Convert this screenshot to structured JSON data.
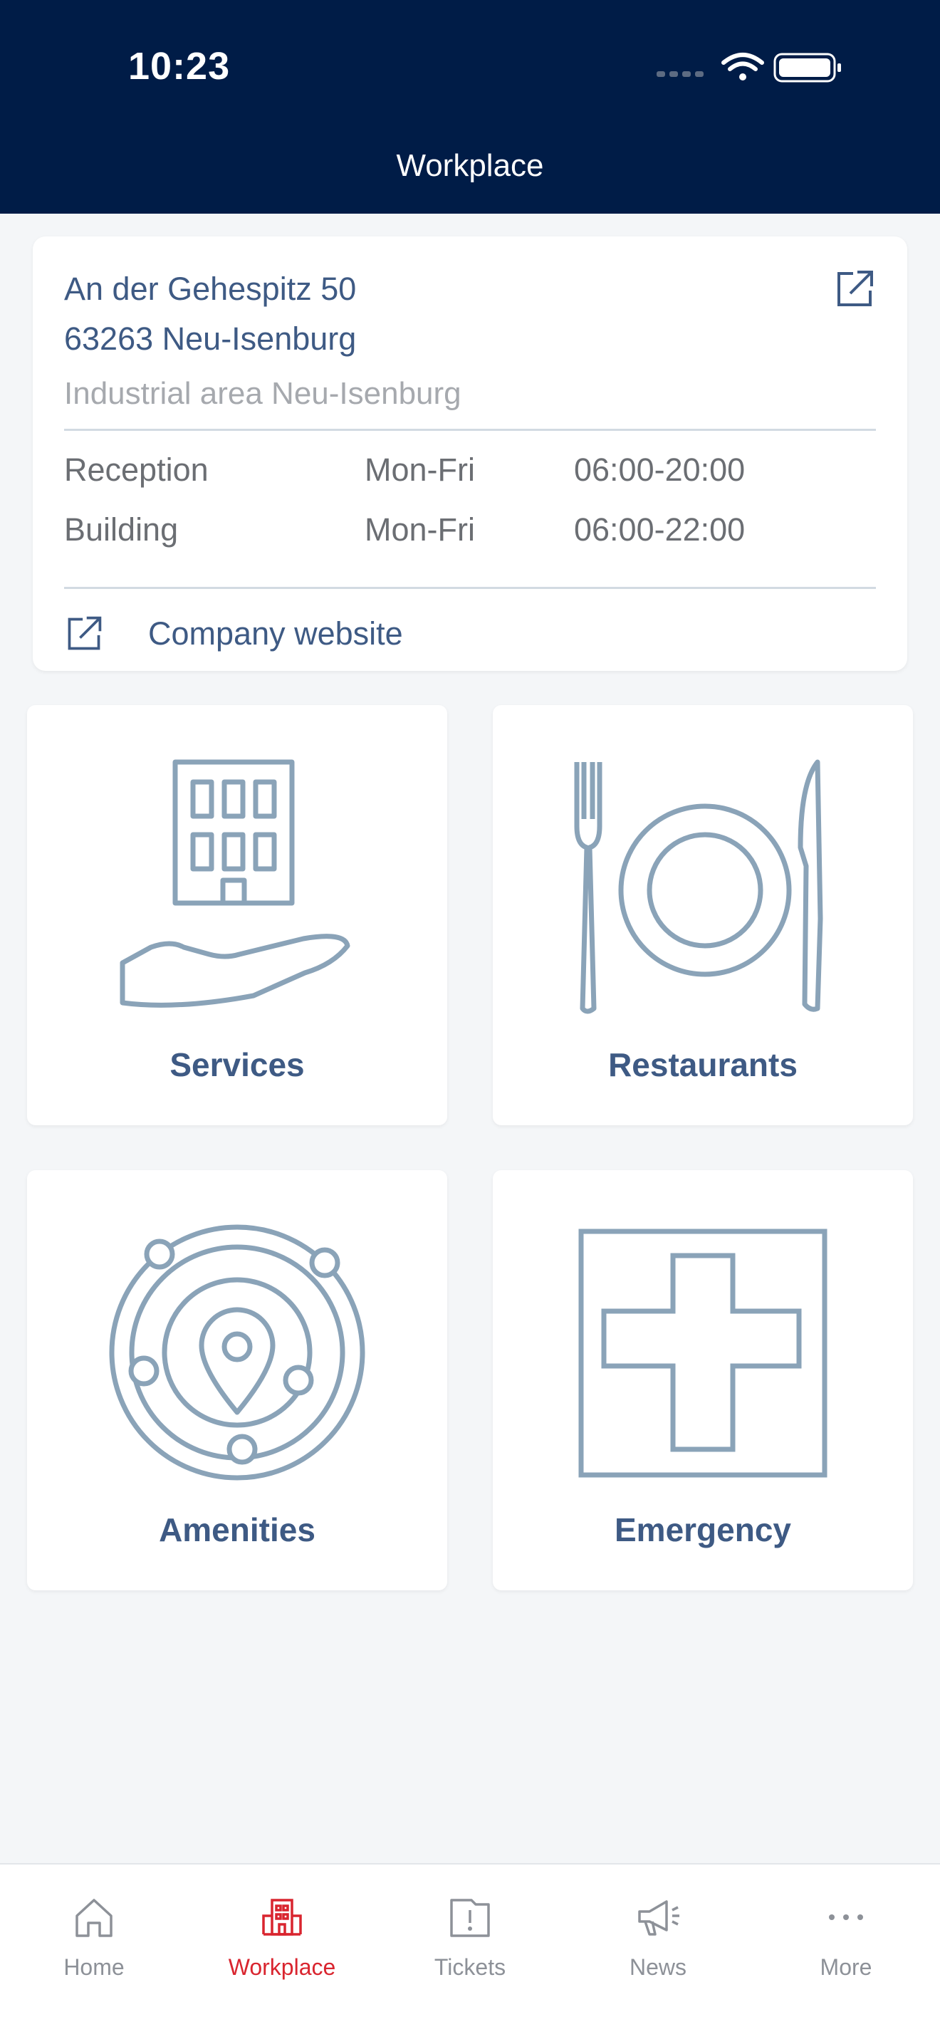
{
  "status_bar": {
    "time": "10:23"
  },
  "header": {
    "title": "Workplace"
  },
  "address_card": {
    "street": "An der Gehespitz 50",
    "city": "63263 Neu-Isenburg",
    "area": "Industrial area Neu-Isenburg",
    "hours": [
      {
        "name": "Reception",
        "days": "Mon-Fri",
        "time": "06:00-20:00"
      },
      {
        "name": "Building",
        "days": "Mon-Fri",
        "time": "06:00-22:00"
      }
    ],
    "website_label": "Company website"
  },
  "tiles": [
    {
      "label": "Services",
      "icon": "building-in-hand-icon"
    },
    {
      "label": "Restaurants",
      "icon": "plate-fork-knife-icon"
    },
    {
      "label": "Amenities",
      "icon": "location-orbit-icon"
    },
    {
      "label": "Emergency",
      "icon": "medical-cross-icon"
    }
  ],
  "tabbar": {
    "items": [
      {
        "label": "Home",
        "icon": "home-icon"
      },
      {
        "label": "Workplace",
        "icon": "building-icon",
        "active": true
      },
      {
        "label": "Tickets",
        "icon": "ticket-icon"
      },
      {
        "label": "News",
        "icon": "megaphone-icon"
      },
      {
        "label": "More",
        "icon": "more-dots-icon"
      }
    ]
  },
  "colors": {
    "header_bg": "#001c47",
    "accent_text": "#3e5a84",
    "icon_stroke": "#8aa3b8",
    "active_tab": "#d9252f",
    "page_bg": "#f4f6f8"
  }
}
